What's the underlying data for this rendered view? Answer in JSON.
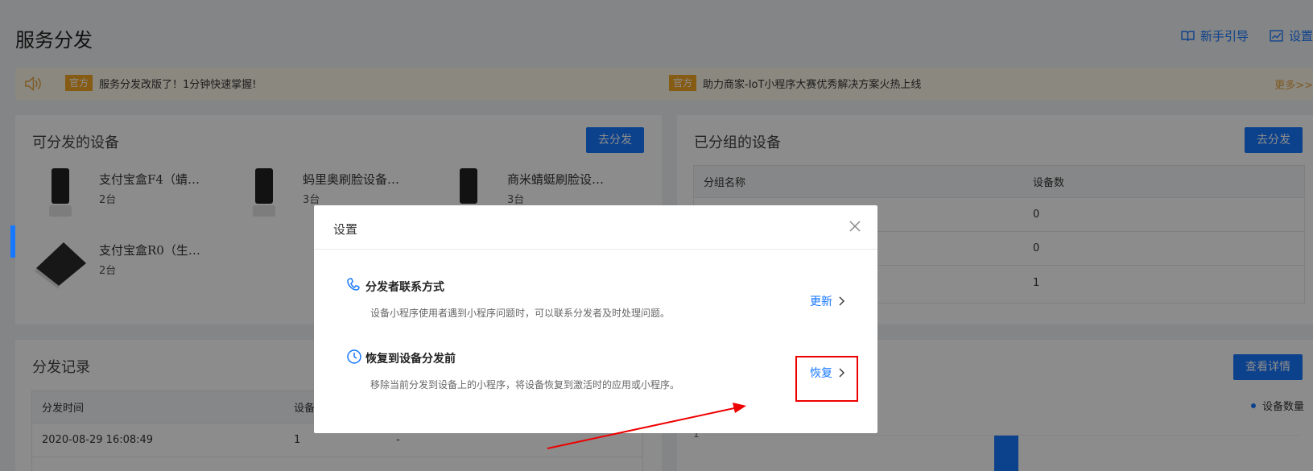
{
  "page": {
    "title": "服务分发",
    "top_actions": [
      {
        "label": "新手引导"
      },
      {
        "label": "设置"
      }
    ]
  },
  "notices": {
    "items": [
      {
        "tag": "官方",
        "text": "服务分发改版了！1分钟快速掌握!"
      },
      {
        "tag": "官方",
        "text": "助力商家-IoT小程序大赛优秀解决方案火热上线"
      }
    ],
    "more": "更多>>"
  },
  "available_devices": {
    "title": "可分发的设备",
    "button": "去分发",
    "devices": [
      {
        "name": "支付宝盒F4（蜻…",
        "count": "2台"
      },
      {
        "name": "蚂里奥刷脸设备…",
        "count": "3台"
      },
      {
        "name": "商米蜻蜓刷脸设…",
        "count": "3台"
      },
      {
        "name": "支付宝盒R0（生…",
        "count": "2台"
      }
    ]
  },
  "grouped_devices": {
    "title": "已分组的设备",
    "button": "去分发",
    "columns": [
      "分组名称",
      "设备数"
    ],
    "rows": [
      {
        "name": "",
        "count": "0"
      },
      {
        "name": "",
        "count": "0"
      },
      {
        "name": "",
        "count": "1"
      }
    ]
  },
  "records": {
    "title": "分发记录",
    "columns": [
      "分发时间",
      "设备"
    ],
    "rows": [
      {
        "time": "2020-08-29 16:08:49",
        "devices": "1",
        "extra": "-"
      }
    ]
  },
  "stats": {
    "button": "查看详情",
    "legend": "设备数量",
    "y_tick": "1"
  },
  "modal": {
    "title": "设置",
    "options": [
      {
        "title": "分发者联系方式",
        "desc": "设备小程序使用者遇到小程序问题时，可以联系分发者及时处理问题。",
        "action": "更新"
      },
      {
        "title": "恢复到设备分发前",
        "desc": "移除当前分发到设备上的小程序，将设备恢复到激活时的应用或小程序。",
        "action": "恢复"
      }
    ]
  },
  "colors": {
    "primary": "#1677ff",
    "tag": "#f5a623",
    "highlight": "#ee0000"
  }
}
